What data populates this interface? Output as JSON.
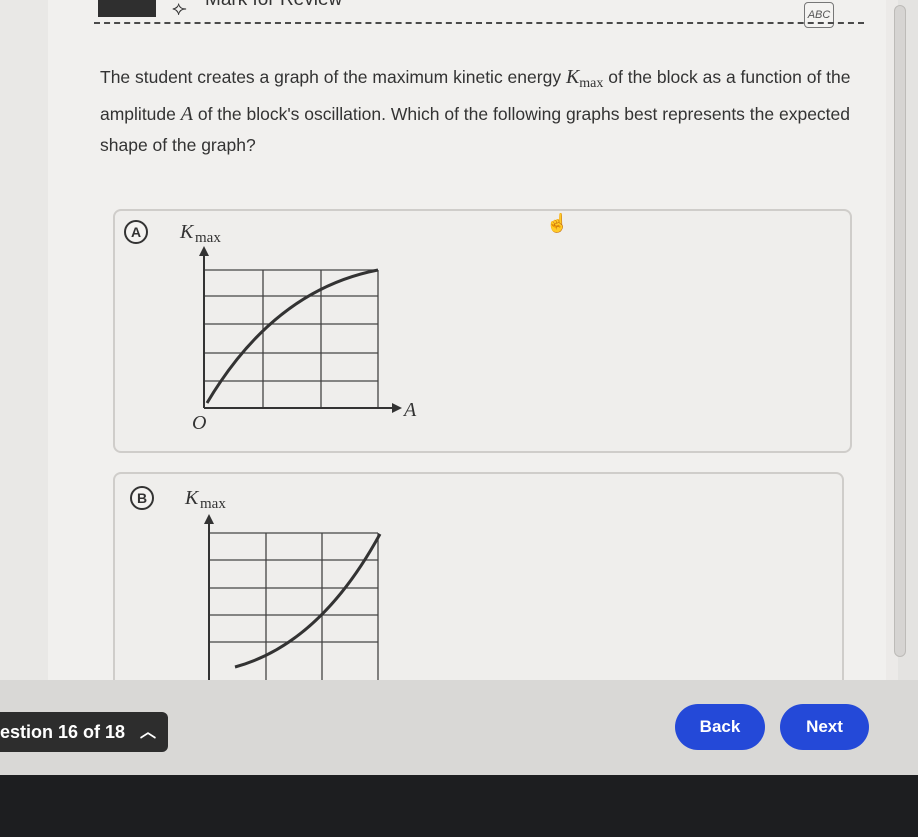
{
  "header": {
    "mark_for_review_label": "Mark for Review",
    "abc_tool_label": "ABC"
  },
  "question": {
    "text_part1": "The student creates a graph of the maximum kinetic energy ",
    "var_K": "K",
    "var_K_sub": "max",
    "text_part2": " of the block as a function of the amplitude ",
    "var_A": "A",
    "text_part3": " of the block's oscillation. Which of the following graphs best represents the expected shape of the graph?"
  },
  "options": [
    {
      "letter": "A",
      "y_label": "K",
      "y_label_sub": "max",
      "x_label": "A",
      "origin_label": "O",
      "curve": "concave-down"
    },
    {
      "letter": "B",
      "y_label": "K",
      "y_label_sub": "max",
      "curve": "concave-up"
    }
  ],
  "footer": {
    "question_nav_label": "estion 16 of 18",
    "back_label": "Back",
    "next_label": "Next"
  },
  "colors": {
    "primary_button": "#2449d8",
    "nav_dark": "#2d2d2d"
  }
}
